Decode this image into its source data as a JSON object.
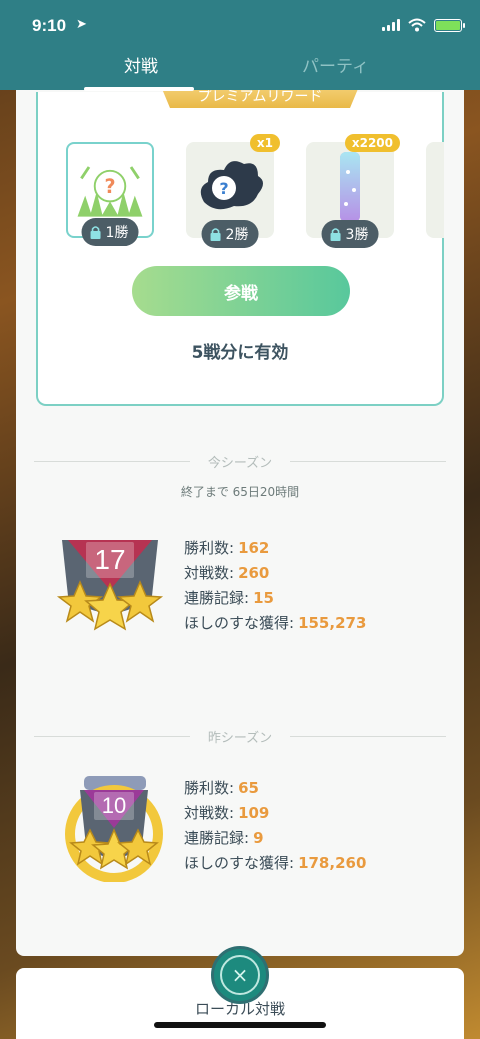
{
  "status": {
    "time": "9:10"
  },
  "tabs": {
    "battle": "対戦",
    "party": "パーティ"
  },
  "premium": {
    "banner": "プレミアムリワード",
    "rewards": [
      {
        "lock_label": "1勝",
        "count": "",
        "icon": "mystery-encounter-icon"
      },
      {
        "lock_label": "2勝",
        "count": "x1",
        "icon": "mystery-pokemon-icon"
      },
      {
        "lock_label": "3勝",
        "count": "x2200",
        "icon": "stardust-icon"
      }
    ],
    "join_button": "参戦",
    "valid_text": "5戦分に有効"
  },
  "current_season": {
    "header": "今シーズン",
    "remaining": "終了まで 65日20時間",
    "rank": "17",
    "stats": [
      {
        "label": "勝利数:",
        "value": "162"
      },
      {
        "label": "対戦数:",
        "value": "260"
      },
      {
        "label": "連勝記録:",
        "value": "15"
      },
      {
        "label": "ほしのすな獲得:",
        "value": "155,273"
      }
    ]
  },
  "last_season": {
    "header": "昨シーズン",
    "rank": "10",
    "stats": [
      {
        "label": "勝利数:",
        "value": "65"
      },
      {
        "label": "対戦数:",
        "value": "109"
      },
      {
        "label": "連勝記録:",
        "value": "9"
      },
      {
        "label": "ほしのすな獲得:",
        "value": "178,260"
      }
    ]
  },
  "bottom": {
    "local_battle": "ローカル対戦",
    "close_symbol": "×"
  },
  "colors": {
    "header": "#2f7f86",
    "accent": "#e99a3e",
    "teal": "#7cd0c4"
  }
}
